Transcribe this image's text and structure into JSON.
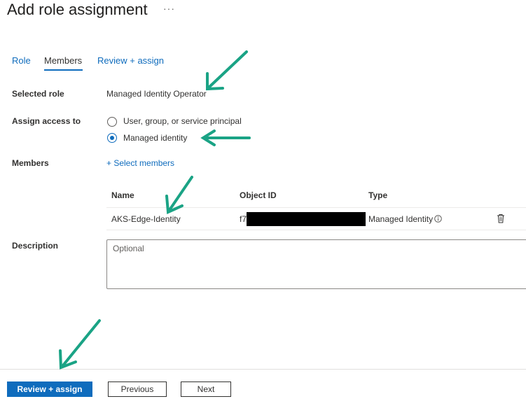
{
  "header": {
    "title": "Add role assignment",
    "more_label": "···"
  },
  "tabs": [
    {
      "label": "Role",
      "active": false
    },
    {
      "label": "Members",
      "active": true
    },
    {
      "label": "Review + assign",
      "active": false
    }
  ],
  "form": {
    "selected_role_label": "Selected role",
    "selected_role_value": "Managed Identity Operator",
    "assign_access_label": "Assign access to",
    "assign_options": [
      {
        "label": "User, group, or service principal",
        "checked": false
      },
      {
        "label": "Managed identity",
        "checked": true
      }
    ],
    "members_label": "Members",
    "select_members_link": "+ Select members",
    "description_label": "Description",
    "description_placeholder": "Optional"
  },
  "members_table": {
    "columns": [
      "Name",
      "Object ID",
      "Type"
    ],
    "rows": [
      {
        "name": "AKS-Edge-Identity",
        "object_id": "f7",
        "type": "Managed Identity"
      }
    ]
  },
  "footer": {
    "review_assign": "Review + assign",
    "previous": "Previous",
    "next": "Next"
  },
  "colors": {
    "accent": "#0f6cbd",
    "annotation_arrow": "#1aa385"
  },
  "icons": [
    "more-icon",
    "radio-icon",
    "info-icon",
    "delete-icon",
    "annotation-arrow-icon"
  ]
}
